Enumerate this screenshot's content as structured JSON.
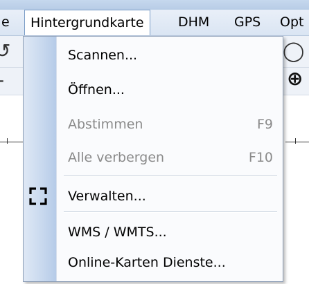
{
  "menubar": {
    "items": [
      {
        "label": "e"
      },
      {
        "label": "Hintergrundkarte"
      },
      {
        "label": "DHM"
      },
      {
        "label": "GPS"
      },
      {
        "label": "Opt"
      }
    ]
  },
  "dropdown": {
    "items": [
      {
        "label": "Scannen...",
        "shortcut": "",
        "enabled": true
      },
      {
        "label": "Öffnen...",
        "shortcut": "",
        "enabled": true
      },
      {
        "label": "Abstimmen",
        "shortcut": "F9",
        "enabled": false
      },
      {
        "label": "Alle verbergen",
        "shortcut": "F10",
        "enabled": false
      },
      {
        "label": "Verwalten...",
        "shortcut": "",
        "enabled": true,
        "icon": "frame-corners-icon"
      },
      {
        "label": "WMS / WMTS...",
        "shortcut": "",
        "enabled": true
      },
      {
        "label": "Online-Karten Dienste...",
        "shortcut": "",
        "enabled": true
      }
    ]
  },
  "colors": {
    "menu_border": "#8e9fb7",
    "gutter": "#c7d8ee",
    "disabled_text": "#8a8a8a",
    "active_menu_border": "#7a9cc6"
  }
}
